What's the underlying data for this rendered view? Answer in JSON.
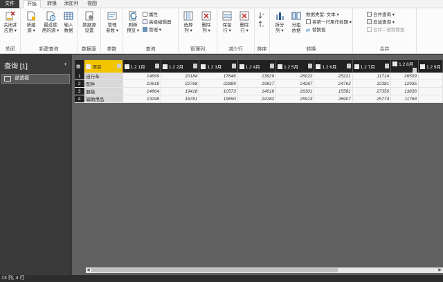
{
  "tabs": [
    "文件",
    "开始",
    "转换",
    "添加列",
    "视图"
  ],
  "ribbon": {
    "groups": {
      "close": {
        "label": "关闭",
        "buttons": [
          "关闭并\n应用 ▾"
        ]
      },
      "new_query": {
        "label": "新建查询",
        "buttons": [
          "新建\n源 ▾",
          "最近使\n用的源 ▾",
          "输入\n数据"
        ]
      },
      "datasource": {
        "label": "数据源",
        "buttons": [
          "数据源\n设置"
        ]
      },
      "params": {
        "label": "参数",
        "buttons": [
          "管理\n参数 ▾"
        ]
      },
      "query": {
        "label": "查询",
        "buttons": [
          "刷新\n预览 ▾"
        ],
        "small": [
          "属性",
          "高级编辑器",
          "管理 ▾"
        ]
      },
      "manage_cols": {
        "label": "管理列",
        "buttons": [
          "选择\n列 ▾",
          "删除\n列 ▾"
        ]
      },
      "reduce_rows": {
        "label": "减少行",
        "buttons": [
          "保留\n行 ▾",
          "删除\n行 ▾"
        ]
      },
      "sort": {
        "label": "排序"
      },
      "transform": {
        "label": "转换",
        "buttons": [
          "拆分\n列 ▾",
          "分组\n依据"
        ],
        "small": [
          "数据类型: 文本 ▾",
          "将第一行用作标题 ▾",
          "替换值"
        ]
      },
      "combine": {
        "label": "合并",
        "small": [
          "合并查询 ▾",
          "追加查询 ▾",
          "合并二进制数据"
        ]
      }
    }
  },
  "left_pane": {
    "title": "查询 [1]",
    "collapse": "‹",
    "items": [
      "逆透视"
    ]
  },
  "table": {
    "columns": [
      "项目",
      "1.2 1月",
      "1.2 2月",
      "1.2 3月",
      "1.2 4月",
      "1.2 5月",
      "1.2 6月",
      "1.2 7月",
      "1.2 8月",
      "1.2 9月"
    ],
    "rows": [
      {
        "n": "1",
        "cells": [
          "自行车",
          "14699",
          "20184",
          "17646",
          "13629",
          "26022",
          "25221",
          "11714",
          "26509"
        ]
      },
      {
        "n": "2",
        "cells": [
          "配件",
          "10618",
          "22768",
          "22889",
          "19817",
          "24267",
          "24762",
          "12381",
          "12935"
        ]
      },
      {
        "n": "3",
        "cells": [
          "服装",
          "14864",
          "19418",
          "10573",
          "14618",
          "26301",
          "15581",
          "27350",
          "13836"
        ]
      },
      {
        "n": "4",
        "cells": [
          "辅助用品",
          "13298",
          "16781",
          "19650",
          "24182",
          "25913",
          "26907",
          "25774",
          "11768"
        ]
      }
    ]
  },
  "status": "13 列, 4 行"
}
